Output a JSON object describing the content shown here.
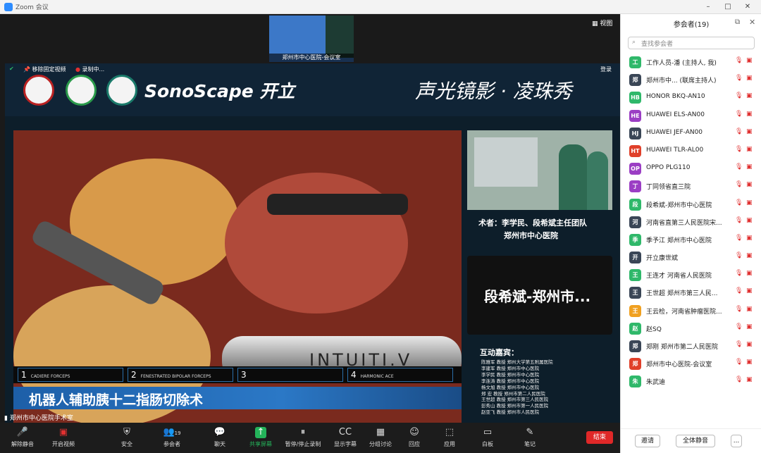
{
  "window": {
    "title": "Zoom 会议"
  },
  "stage": {
    "thumb_label": "郑州市中心医院-会议室",
    "view_label": "视图",
    "rec": {
      "remove_pin": "移除固定视频",
      "recording": "录制中...",
      "login": "登录"
    },
    "slide": {
      "brand": "SonoScape 开立",
      "slogan": "声光镜影 · 凌珠秀",
      "instrument_text": "INTUITI.V",
      "tools": [
        {
          "num": "1",
          "name": "CADIERE FORCEPS"
        },
        {
          "num": "2",
          "name": "FENESTRATED BIPOLAR FORCEPS"
        },
        {
          "num": "3",
          "name": ""
        },
        {
          "num": "4",
          "name": "HARMONIC ACE"
        }
      ],
      "caption": "机器人辅助胰十二指肠切除术",
      "surgeon_line1": "术者：李学民、段希斌主任团队",
      "surgeon_line2": "郑州市中心医院",
      "speaker_name": "段希斌-郑州市...",
      "guests_title": "互动嘉宾：",
      "guests": [
        "陈雅军 教授 郑州大学第五附属医院",
        "李建军 教授 郑州市中心医院",
        "李学民 教授 郑州市中心医院",
        "李连涛 教授 郑州市中心医院",
        "杨文旭 教授 郑州市中心医院",
        "郑 宏 教授 郑州市第二人民医院",
        "王世超 教授 郑州市第三人民医院",
        "彭秀山 教授 郑州市第一人民医院",
        "赵亚飞 教授 郑州市人民医院"
      ]
    },
    "room_label": "郑州市中心医院手术室"
  },
  "toolbar": {
    "items": [
      {
        "label": "解除静音",
        "icon": "mic-muted-icon"
      },
      {
        "label": "开启视频",
        "icon": "camera-off-icon"
      },
      {
        "label": "安全",
        "icon": "shield-icon"
      },
      {
        "label": "参会者",
        "icon": "participants-icon",
        "count": "19"
      },
      {
        "label": "聊天",
        "icon": "chat-icon"
      },
      {
        "label": "共享屏幕",
        "icon": "share-screen-icon"
      },
      {
        "label": "暂停/停止录制",
        "icon": "pause-record-icon"
      },
      {
        "label": "显示字幕",
        "icon": "captions-icon"
      },
      {
        "label": "分组讨论",
        "icon": "breakout-icon"
      },
      {
        "label": "回应",
        "icon": "reaction-icon"
      },
      {
        "label": "应用",
        "icon": "apps-icon"
      },
      {
        "label": "白板",
        "icon": "whiteboard-icon"
      },
      {
        "label": "笔记",
        "icon": "notes-icon"
      }
    ],
    "end_label": "结束"
  },
  "panel": {
    "title": "参会者(19)",
    "search_placeholder": "查找参会者",
    "participants": [
      {
        "avatar": "工",
        "name": "工作人员-潘 (主持人, 我)",
        "color": "#2fb86a"
      },
      {
        "avatar": "郑",
        "name": "郑州市中... (联席主持人)",
        "color": "#3a4656"
      },
      {
        "avatar": "HB",
        "name": "HONOR BKQ-AN10",
        "color": "#2fb86a"
      },
      {
        "avatar": "HE",
        "name": "HUAWEI ELS-AN00",
        "color": "#9b3ec4"
      },
      {
        "avatar": "HJ",
        "name": "HUAWEI JEF-AN00",
        "color": "#3a4656"
      },
      {
        "avatar": "HT",
        "name": "HUAWEI TLR-AL00",
        "color": "#e0402a"
      },
      {
        "avatar": "OP",
        "name": "OPPO PLG110",
        "color": "#9b3ec4"
      },
      {
        "avatar": "丁",
        "name": "丁同领省直三院",
        "color": "#9b3ec4"
      },
      {
        "avatar": "段",
        "name": "段希斌-郑州市中心医院",
        "color": "#2fb86a"
      },
      {
        "avatar": "河",
        "name": "河南省直第三人民医院宋...",
        "color": "#3a4656"
      },
      {
        "avatar": "季",
        "name": "季予江 郑州市中心医院",
        "color": "#2fb86a"
      },
      {
        "avatar": "开",
        "name": "开立康世斌",
        "color": "#3a4656"
      },
      {
        "avatar": "王",
        "name": "王连才 河南省人民医院",
        "color": "#2fb86a"
      },
      {
        "avatar": "王",
        "name": "王世超 郑州市第三人民...",
        "color": "#3a4656"
      },
      {
        "avatar": "王",
        "name": "王云检，河南省肿瘤医院...",
        "color": "#f0a020"
      },
      {
        "avatar": "赵",
        "name": "赵SQ",
        "color": "#2fb86a"
      },
      {
        "avatar": "郑",
        "name": "郑刚 郑州市第二人民医院",
        "color": "#3a4656"
      },
      {
        "avatar": "郑",
        "name": "郑州市中心医院-会议室",
        "color": "#e0402a"
      },
      {
        "avatar": "朱",
        "name": "朱武迪",
        "color": "#2fb86a"
      }
    ],
    "invite_label": "邀请",
    "mute_all_label": "全体静音",
    "more_label": "..."
  }
}
